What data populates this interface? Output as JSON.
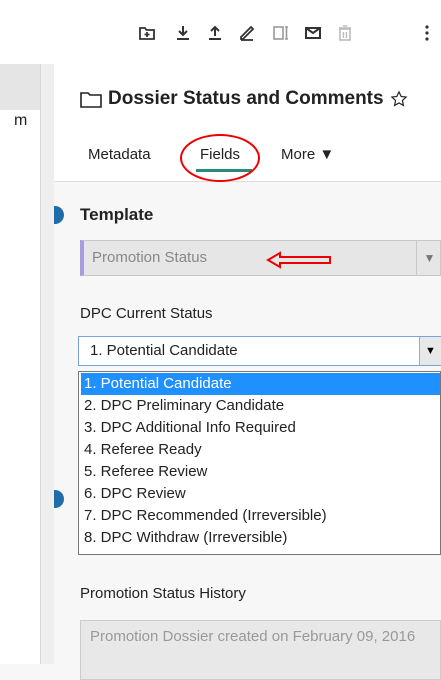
{
  "toolbar": {
    "icons": [
      "add-folder-icon",
      "download-icon",
      "upload-icon",
      "edit-icon",
      "text-field-icon",
      "email-icon",
      "delete-icon",
      "more-vert-icon"
    ]
  },
  "left_panel": {
    "text": "m"
  },
  "panel": {
    "title": "Dossier Status and Comments",
    "tabs": [
      {
        "label": "Metadata"
      },
      {
        "label": "Fields",
        "active": true
      },
      {
        "label": "More ▼"
      }
    ],
    "template": {
      "heading": "Template",
      "value": "Promotion Status"
    },
    "dpc_status": {
      "label": "DPC Current Status",
      "value": "1. Potential Candidate",
      "options": [
        "1. Potential Candidate",
        "2. DPC Preliminary Candidate",
        "3. DPC Additional Info Required",
        "4. Referee Ready",
        "5. Referee Review",
        "6. DPC Review",
        "7. DPC Recommended (Irreversible)",
        "8. DPC Withdraw (Irreversible)"
      ],
      "selected_index": 0
    },
    "history": {
      "label": "Promotion Status History",
      "value": "Promotion Dossier created on February 09, 2016"
    }
  },
  "colors": {
    "accent": "#1e90ff",
    "annotation": "#e00000",
    "tab_underline": "#2a8a7a",
    "marker": "#1f6da8"
  }
}
